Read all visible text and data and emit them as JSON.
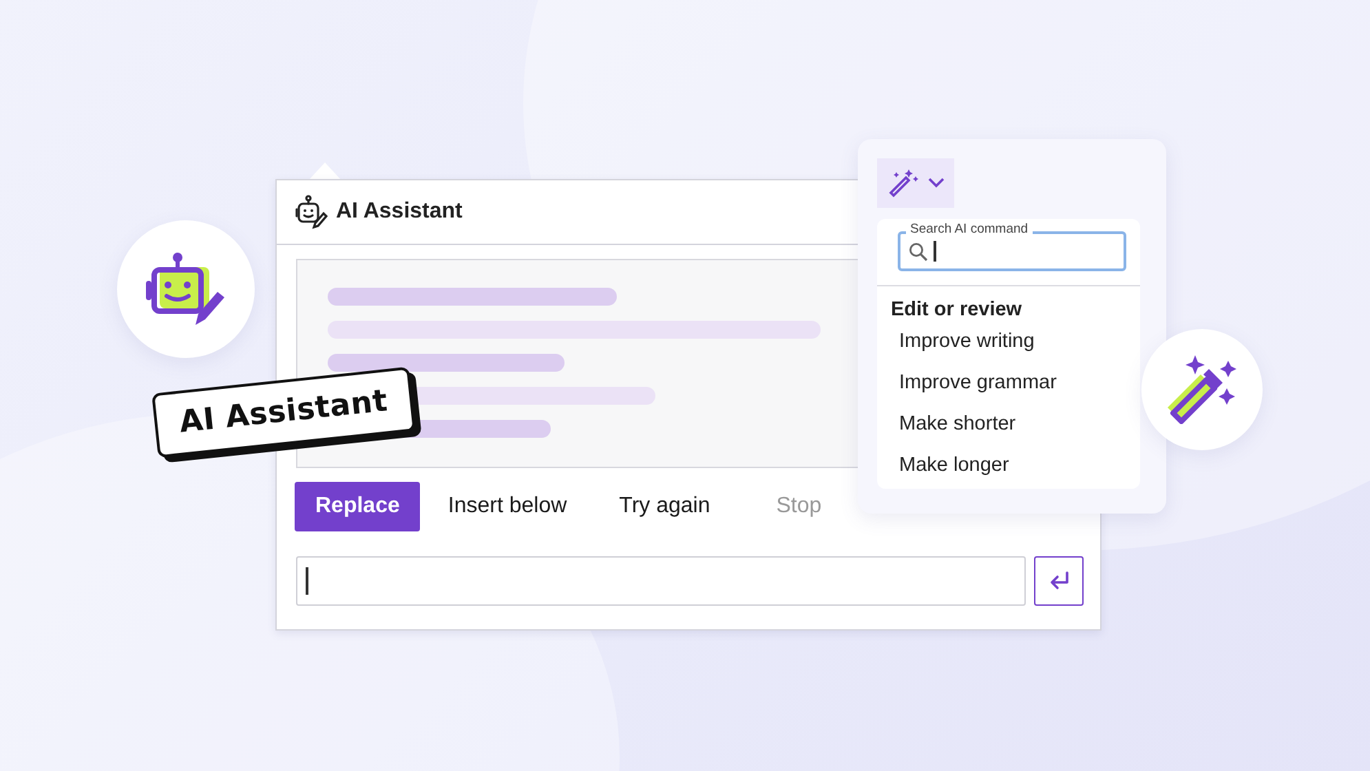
{
  "panel": {
    "title": "AI Assistant"
  },
  "actions": [
    {
      "label": "Replace",
      "kind": "primary",
      "disabled": false
    },
    {
      "label": "Insert below",
      "kind": "plain",
      "disabled": false
    },
    {
      "label": "Try again",
      "kind": "plain",
      "disabled": false
    },
    {
      "label": "Stop",
      "kind": "plain",
      "disabled": true
    }
  ],
  "menu": {
    "search_label": "Search AI command",
    "section": "Edit or review",
    "items": [
      "Improve writing",
      "Improve grammar",
      "Make shorter",
      "Make longer"
    ]
  },
  "sticker": "AI Assistant"
}
